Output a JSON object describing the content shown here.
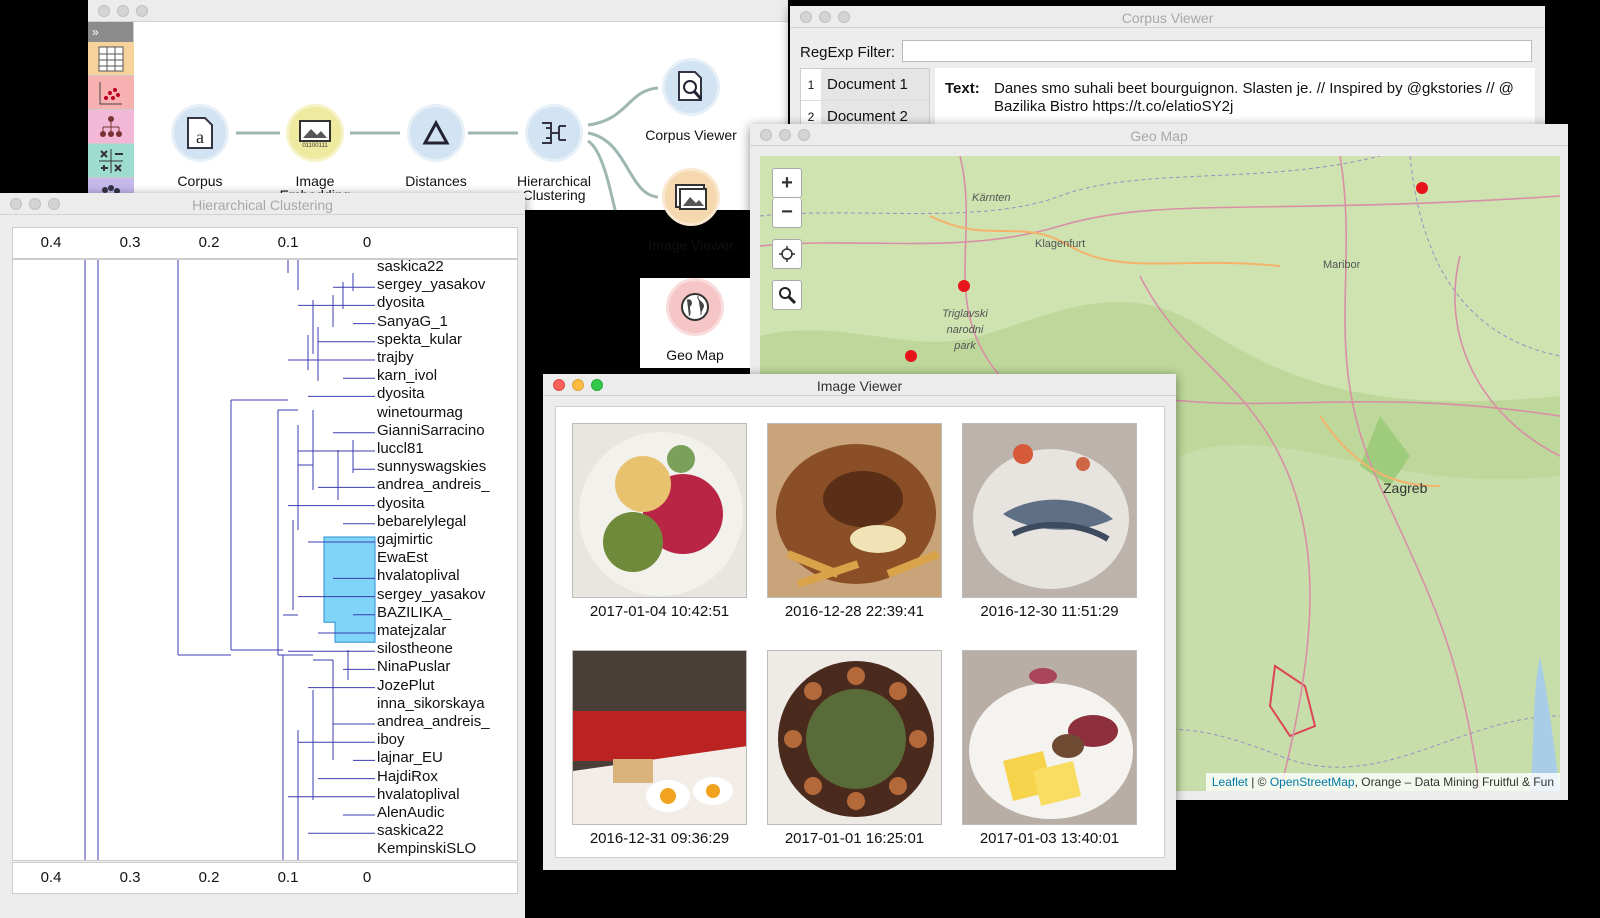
{
  "canvas": {
    "nodes": [
      {
        "label": "Corpus"
      },
      {
        "label": "Image Embedding"
      },
      {
        "label": "Distances"
      },
      {
        "label": "Hierarchical Clustering"
      },
      {
        "label": "Corpus Viewer"
      },
      {
        "label": "Image Viewer"
      },
      {
        "label": "Geo Map"
      }
    ],
    "category_toggle": "»"
  },
  "corpus_viewer": {
    "title": "Corpus Viewer",
    "filter_label": "RegExp Filter:",
    "filter_value": "",
    "documents": [
      {
        "num": "1",
        "name": "Document 1"
      },
      {
        "num": "2",
        "name": "Document 2"
      }
    ],
    "text_label": "Text:",
    "text_value": "Danes smo suhali beet bourguignon. Slasten je. // Inspired by @gkstories // @ Bazilika Bistro https://t.co/elatioSY2j"
  },
  "hierarchical_clustering": {
    "title": "Hierarchical Clustering",
    "axis_ticks": [
      "0.4",
      "0.3",
      "0.2",
      "0.1",
      "0"
    ],
    "leaves": [
      "saskica22",
      "sergey_yasakov",
      "dyosita",
      "SanyaG_1",
      "spekta_kular",
      "trajby",
      "karn_ivol",
      "dyosita",
      "winetourmag",
      "GianniSarracino",
      "luccl81",
      "sunnyswagskies",
      "andrea_andreis_",
      "dyosita",
      "bebarelylegal",
      "gajmirtic",
      "EwaEst",
      "hvalatoplival",
      "sergey_yasakov",
      "BAZILIKA_",
      "matejzalar",
      "silostheone",
      "NinaPuslar",
      "JozePlut",
      "inna_sikorskaya",
      "andrea_andreis_",
      "iboy",
      "lajnar_EU",
      "HajdiRox",
      "hvalatoplival",
      "AlenAudic",
      "saskica22",
      "KempinskiSLO"
    ],
    "selected_color": "#7fd4f7"
  },
  "geo_map": {
    "title": "Geo Map",
    "zoom_in": "+",
    "zoom_out": "−",
    "places": [
      "Kärnten",
      "Klagenfurt",
      "Maribor",
      "Triglavski narodni park",
      "Zagreb"
    ],
    "attribution_leaflet": "Leaflet",
    "attribution_osm": "OpenStreetMap",
    "attribution_sep": " | © ",
    "attribution_rest": ", Orange – Data Mining Fruitful & Fun"
  },
  "image_viewer": {
    "title": "Image Viewer",
    "images": [
      {
        "timestamp": "2017-01-04 10:42:51",
        "icon": "salad-plate-photo"
      },
      {
        "timestamp": "2016-12-28 22:39:41",
        "icon": "fries-meat-photo"
      },
      {
        "timestamp": "2016-12-30 11:51:29",
        "icon": "fish-dish-photo"
      },
      {
        "timestamp": "2016-12-31 09:36:29",
        "icon": "breakfast-eggs-photo"
      },
      {
        "timestamp": "2017-01-01 16:25:01",
        "icon": "dessert-balls-photo"
      },
      {
        "timestamp": "2017-01-03 13:40:01",
        "icon": "cheese-ham-photo"
      }
    ]
  }
}
